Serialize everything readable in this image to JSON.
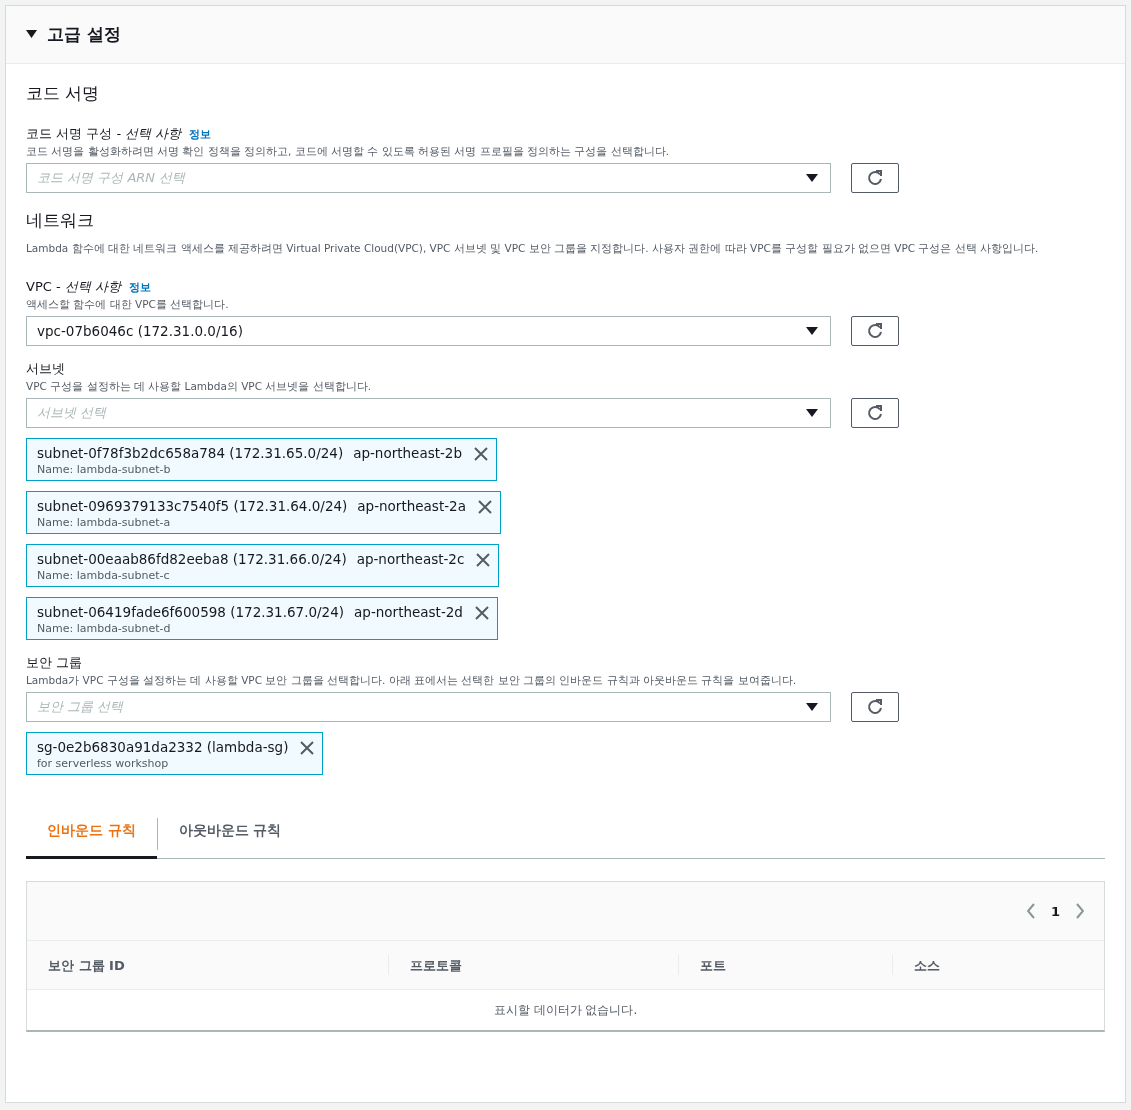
{
  "panel": {
    "title": "고급 설정",
    "expanded": true
  },
  "sections": [
    {
      "title": "코드 서명",
      "fields": [
        {
          "label": "코드 서명 구성 - *선택 사항*",
          "info": "정보",
          "description": "코드 서명을 활성화하려면 서명 확인 정책을 정의하고, 코드에 서명할 수 있도록 허용된 서명 프로필을 정의하는 구성을 선택합니다.",
          "select": {
            "placeholder": "코드 서명 구성 ARN 선택"
          }
        }
      ]
    },
    {
      "title": "네트워크",
      "description": "Lambda 함수에 대한 네트워크 액세스를 제공하려면 Virtual Private Cloud(VPC), VPC 서브넷 및 VPC 보안 그룹을 지정합니다. 사용자 권한에 따라 VPC를 구성할 필요가 없으면 VPC 구성은 선택 사항입니다.",
      "fields": [
        {
          "label": "VPC - *선택 사항*",
          "info": "정보",
          "description": "액세스할 함수에 대한 VPC를 선택합니다.",
          "select": {
            "value": "vpc-07b6046c (172.31.0.0/16)"
          }
        },
        {
          "label": "서브넷",
          "description": "VPC 구성을 설정하는 데 사용할 Lambda의 VPC 서브넷을 선택합니다.",
          "select": {
            "placeholder": "서브넷 선택"
          },
          "tokens": [
            {
              "title": "subnet-0f78f3b2dc658a784 (172.31.65.0/24)",
              "tag": "ap-northeast-2b",
              "detail": "Name: lambda-subnet-b"
            },
            {
              "title": "subnet-0969379133c7540f5 (172.31.64.0/24)",
              "tag": "ap-northeast-2a",
              "detail": "Name: lambda-subnet-a"
            },
            {
              "title": "subnet-00eaab86fd82eeba8 (172.31.66.0/24)",
              "tag": "ap-northeast-2c",
              "detail": "Name: lambda-subnet-c"
            },
            {
              "title": "subnet-06419fade6f600598 (172.31.67.0/24)",
              "tag": "ap-northeast-2d",
              "detail": "Name: lambda-subnet-d"
            }
          ]
        },
        {
          "label": "보안 그룹",
          "description": "Lambda가 VPC 구성을 설정하는 데 사용할 VPC 보안 그룹을 선택합니다. 아래 표에서는 선택한 보안 그룹의 인바운드 규칙과 아웃바운드 규칙을 보여줍니다.",
          "select": {
            "placeholder": "보안 그룹 선택"
          },
          "tokens": [
            {
              "title": "sg-0e2b6830a91da2332 (lambda-sg)",
              "detail": "for serverless workshop"
            }
          ]
        }
      ]
    }
  ],
  "rule_tabs": [
    {
      "label": "인바운드 규칙",
      "selected": true
    },
    {
      "label": "아웃바운드 규칙",
      "selected": false
    }
  ],
  "rules_table": {
    "page": "1",
    "columns": [
      "보안 그룹 ID",
      "프로토콜",
      "포트",
      "소스"
    ],
    "empty_message": "표시할 데이터가 없습니다."
  }
}
